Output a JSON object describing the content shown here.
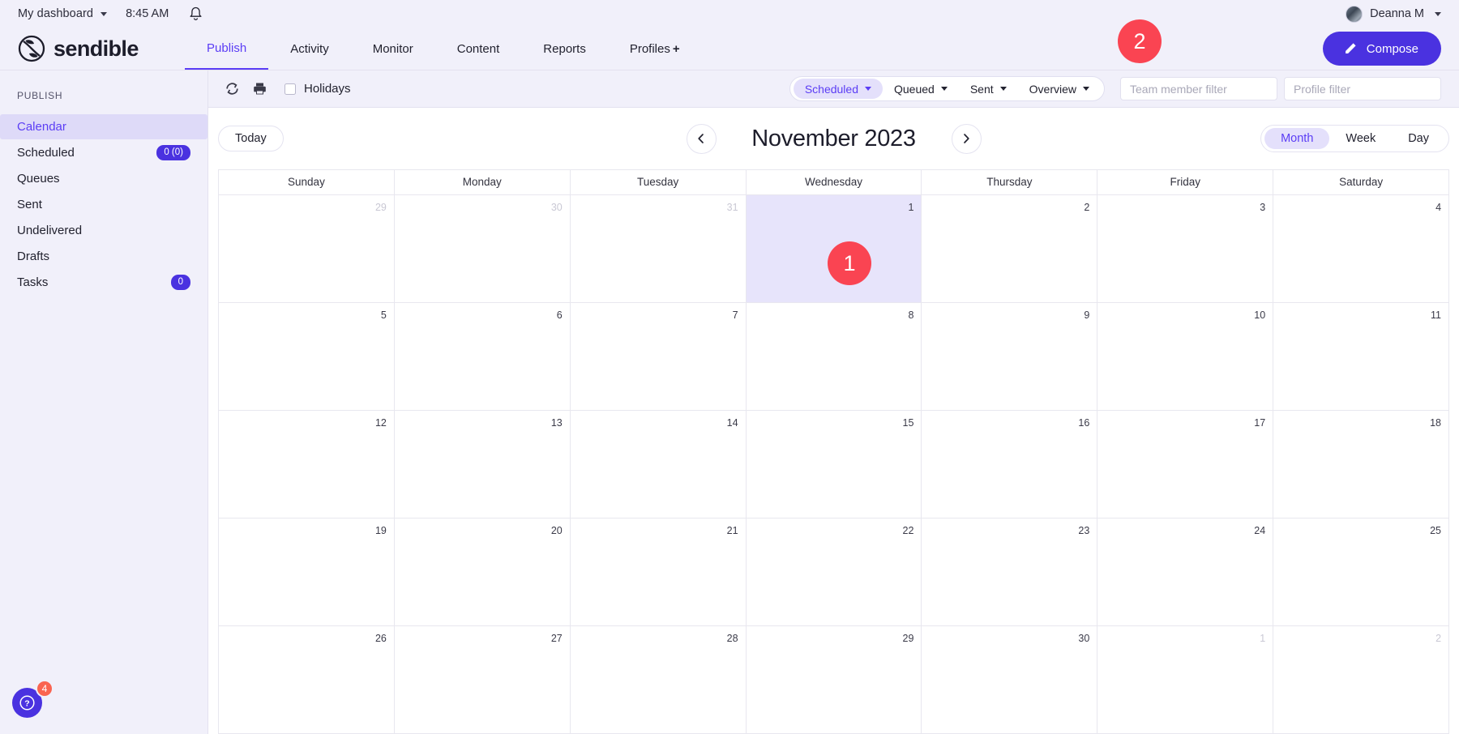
{
  "topbar": {
    "dashboard_label": "My dashboard",
    "time": "8:45 AM",
    "bell_icon": "bell-icon",
    "user_name": "Deanna M"
  },
  "nav": {
    "logo_text": "sendible",
    "items": [
      {
        "label": "Publish",
        "active": true
      },
      {
        "label": "Activity",
        "active": false
      },
      {
        "label": "Monitor",
        "active": false
      },
      {
        "label": "Content",
        "active": false
      },
      {
        "label": "Reports",
        "active": false
      },
      {
        "label": "Profiles",
        "active": false,
        "suffix": "+"
      }
    ],
    "compose_label": "Compose",
    "compose_icon": "pencil-icon",
    "compose_color": "#4a32e0"
  },
  "annotations": {
    "bubble_top_right": "2",
    "bubble_calendar": "1",
    "bubble_color": "#fa4452"
  },
  "sidebar": {
    "section_title": "PUBLISH",
    "items": [
      {
        "label": "Calendar",
        "badge": "",
        "active": true
      },
      {
        "label": "Scheduled",
        "badge": "0 (0)",
        "active": false
      },
      {
        "label": "Queues",
        "badge": "",
        "active": false
      },
      {
        "label": "Sent",
        "badge": "",
        "active": false
      },
      {
        "label": "Undelivered",
        "badge": "",
        "active": false
      },
      {
        "label": "Drafts",
        "badge": "",
        "active": false
      },
      {
        "label": "Tasks",
        "badge": "0",
        "active": false
      }
    ],
    "help_icon": "question-mark-icon",
    "help_badge": "4"
  },
  "filter_bar": {
    "refresh_icon": "refresh-icon",
    "print_icon": "print-icon",
    "holidays_label": "Holidays",
    "holidays_checked": false,
    "pills": [
      {
        "label": "Scheduled",
        "active": true
      },
      {
        "label": "Queued",
        "active": false
      },
      {
        "label": "Sent",
        "active": false
      },
      {
        "label": "Overview",
        "active": false
      }
    ],
    "team_filter_placeholder": "Team member filter",
    "team_filter_value": "",
    "profile_filter_placeholder": "Profile filter",
    "profile_filter_value": ""
  },
  "calendar": {
    "today_label": "Today",
    "prev_icon": "chevron-left-icon",
    "next_icon": "chevron-right-icon",
    "title": "November 2023",
    "views": [
      {
        "label": "Month",
        "active": true
      },
      {
        "label": "Week",
        "active": false
      },
      {
        "label": "Day",
        "active": false
      }
    ],
    "day_headers": [
      "Sunday",
      "Monday",
      "Tuesday",
      "Wednesday",
      "Thursday",
      "Friday",
      "Saturday"
    ],
    "weeks": [
      [
        {
          "num": "29",
          "muted": true,
          "today": false
        },
        {
          "num": "30",
          "muted": true,
          "today": false
        },
        {
          "num": "31",
          "muted": true,
          "today": false
        },
        {
          "num": "1",
          "muted": false,
          "today": true
        },
        {
          "num": "2",
          "muted": false,
          "today": false
        },
        {
          "num": "3",
          "muted": false,
          "today": false
        },
        {
          "num": "4",
          "muted": false,
          "today": false
        }
      ],
      [
        {
          "num": "5",
          "muted": false,
          "today": false
        },
        {
          "num": "6",
          "muted": false,
          "today": false
        },
        {
          "num": "7",
          "muted": false,
          "today": false
        },
        {
          "num": "8",
          "muted": false,
          "today": false
        },
        {
          "num": "9",
          "muted": false,
          "today": false
        },
        {
          "num": "10",
          "muted": false,
          "today": false
        },
        {
          "num": "11",
          "muted": false,
          "today": false
        }
      ],
      [
        {
          "num": "12",
          "muted": false,
          "today": false
        },
        {
          "num": "13",
          "muted": false,
          "today": false
        },
        {
          "num": "14",
          "muted": false,
          "today": false
        },
        {
          "num": "15",
          "muted": false,
          "today": false
        },
        {
          "num": "16",
          "muted": false,
          "today": false
        },
        {
          "num": "17",
          "muted": false,
          "today": false
        },
        {
          "num": "18",
          "muted": false,
          "today": false
        }
      ],
      [
        {
          "num": "19",
          "muted": false,
          "today": false
        },
        {
          "num": "20",
          "muted": false,
          "today": false
        },
        {
          "num": "21",
          "muted": false,
          "today": false
        },
        {
          "num": "22",
          "muted": false,
          "today": false
        },
        {
          "num": "23",
          "muted": false,
          "today": false
        },
        {
          "num": "24",
          "muted": false,
          "today": false
        },
        {
          "num": "25",
          "muted": false,
          "today": false
        }
      ],
      [
        {
          "num": "26",
          "muted": false,
          "today": false
        },
        {
          "num": "27",
          "muted": false,
          "today": false
        },
        {
          "num": "28",
          "muted": false,
          "today": false
        },
        {
          "num": "29",
          "muted": false,
          "today": false
        },
        {
          "num": "30",
          "muted": false,
          "today": false
        },
        {
          "num": "1",
          "muted": true,
          "today": false
        },
        {
          "num": "2",
          "muted": true,
          "today": false
        }
      ]
    ]
  }
}
